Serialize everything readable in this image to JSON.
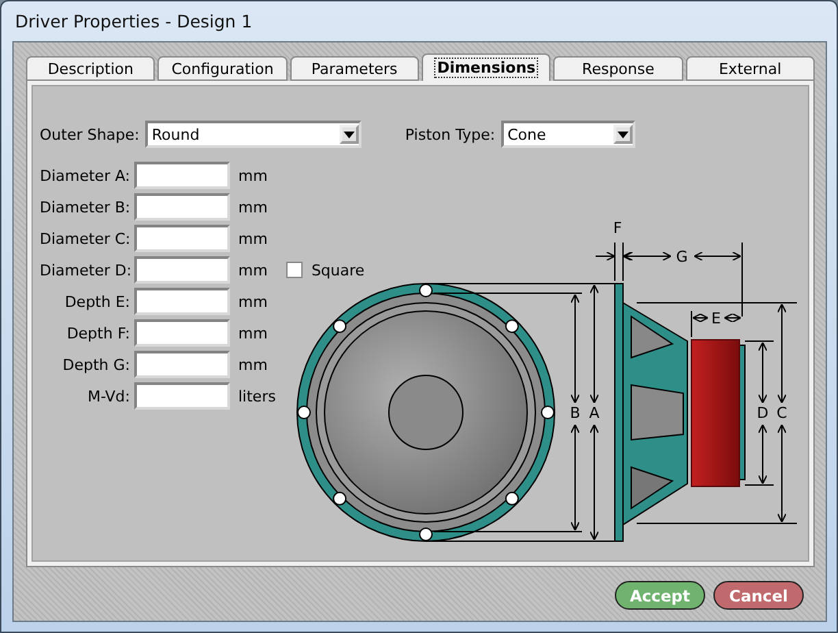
{
  "window": {
    "title": "Driver Properties - Design 1"
  },
  "tabs": [
    {
      "label": "Description",
      "selected": false
    },
    {
      "label": "Configuration",
      "selected": false
    },
    {
      "label": "Parameters",
      "selected": false
    },
    {
      "label": "Dimensions",
      "selected": true
    },
    {
      "label": "Response",
      "selected": false
    },
    {
      "label": "External",
      "selected": false
    }
  ],
  "outer_shape": {
    "label": "Outer Shape:",
    "value": "Round"
  },
  "piston_type": {
    "label": "Piston Type:",
    "value": "Cone"
  },
  "fields": [
    {
      "label": "Diameter A:",
      "unit": "mm"
    },
    {
      "label": "Diameter B:",
      "unit": "mm"
    },
    {
      "label": "Diameter C:",
      "unit": "mm"
    },
    {
      "label": "Diameter D:",
      "unit": "mm",
      "option": {
        "label": "Square",
        "checked": false
      }
    },
    {
      "label": "Depth E:",
      "unit": "mm"
    },
    {
      "label": "Depth F:",
      "unit": "mm"
    },
    {
      "label": "Depth G:",
      "unit": "mm"
    },
    {
      "label": "M-Vd:",
      "unit": "liters"
    }
  ],
  "dimension_labels": [
    "F",
    "G",
    "E",
    "B",
    "A",
    "D",
    "C"
  ],
  "buttons": [
    {
      "label": "Accept",
      "kind": "accept"
    },
    {
      "label": "Cancel",
      "kind": "cancel"
    }
  ]
}
